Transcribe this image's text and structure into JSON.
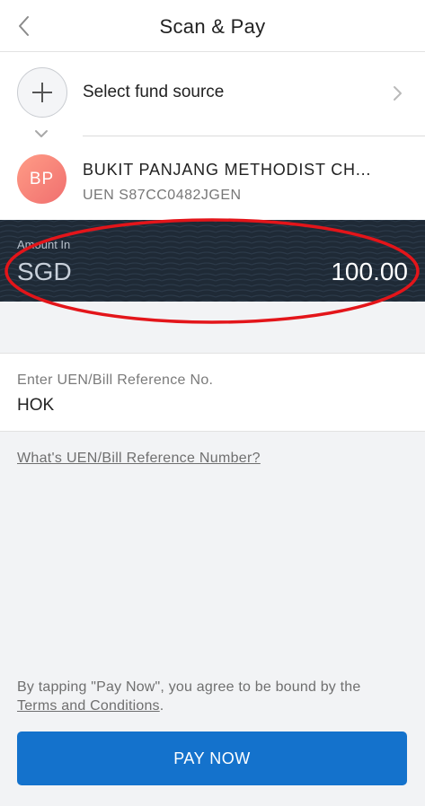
{
  "header": {
    "title": "Scan & Pay",
    "back_icon": "chevron-left-icon"
  },
  "fund_source": {
    "label": "Select fund source",
    "add_icon": "plus-icon",
    "arrow_icon": "chevron-right-icon",
    "expand_icon": "chevron-down-icon"
  },
  "payee": {
    "initials": "BP",
    "name": "BUKIT PANJANG METHODIST CH...",
    "uen": "UEN S87CC0482JGEN"
  },
  "amount": {
    "label": "Amount In",
    "currency": "SGD",
    "value": "100.00"
  },
  "reference": {
    "label": "Enter UEN/Bill Reference No.",
    "value": "HOK"
  },
  "help_link": "What's UEN/Bill Reference Number?",
  "terms": {
    "text": "By tapping \"Pay Now\", you agree to be bound by the",
    "link": "Terms and Conditions",
    "suffix": "."
  },
  "pay_button": "PAY NOW",
  "colors": {
    "primary_button": "#1472cc",
    "amount_background": "#1f2a36",
    "annotation": "#e3151a"
  }
}
